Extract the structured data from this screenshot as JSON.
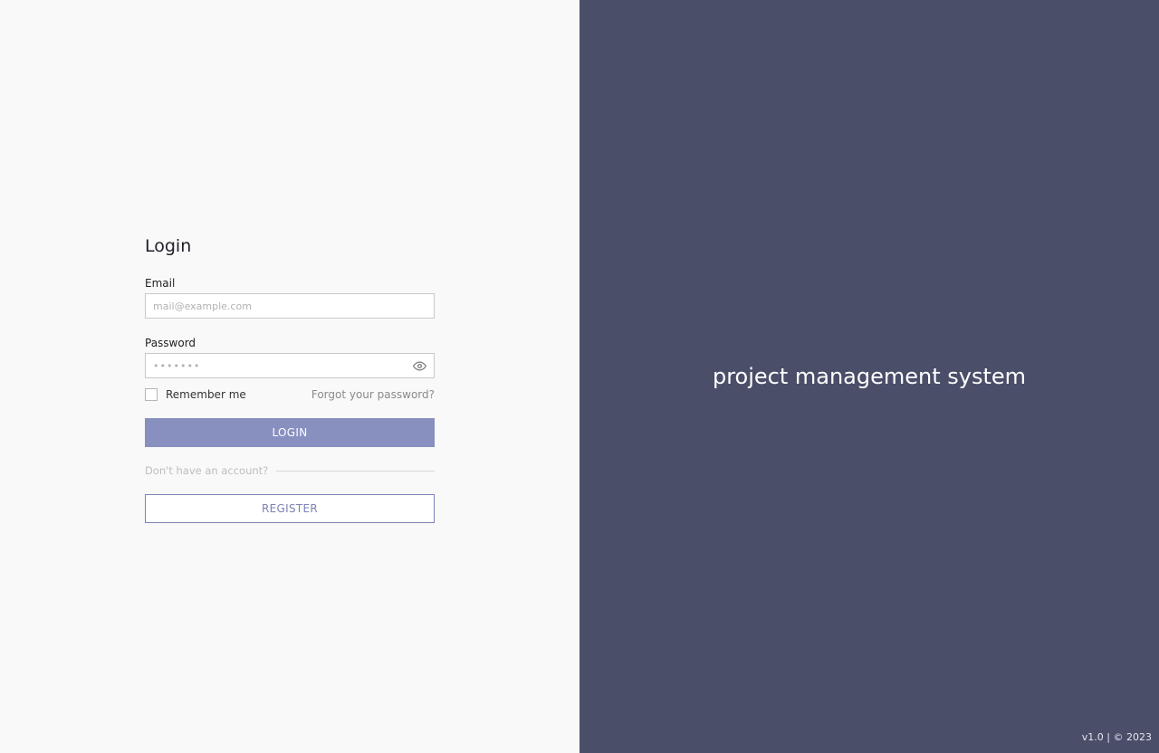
{
  "login": {
    "title": "Login",
    "email_label": "Email",
    "email_placeholder": "mail@example.com",
    "password_label": "Password",
    "password_placeholder": "•••••••",
    "remember_label": "Remember me",
    "forgot_link": "Forgot your password?",
    "login_button": "LOGIN",
    "no_account_text": "Don't have an account?",
    "register_button": "REGISTER"
  },
  "brand": {
    "title": "project management system",
    "version": "v1.0 | © 2023"
  },
  "icons": {
    "password_toggle": "eye-icon"
  },
  "colors": {
    "left_background": "#f9f9f9",
    "right_background": "#4a4e69",
    "primary_button": "#8890c0",
    "register_border": "#7b82b5"
  }
}
